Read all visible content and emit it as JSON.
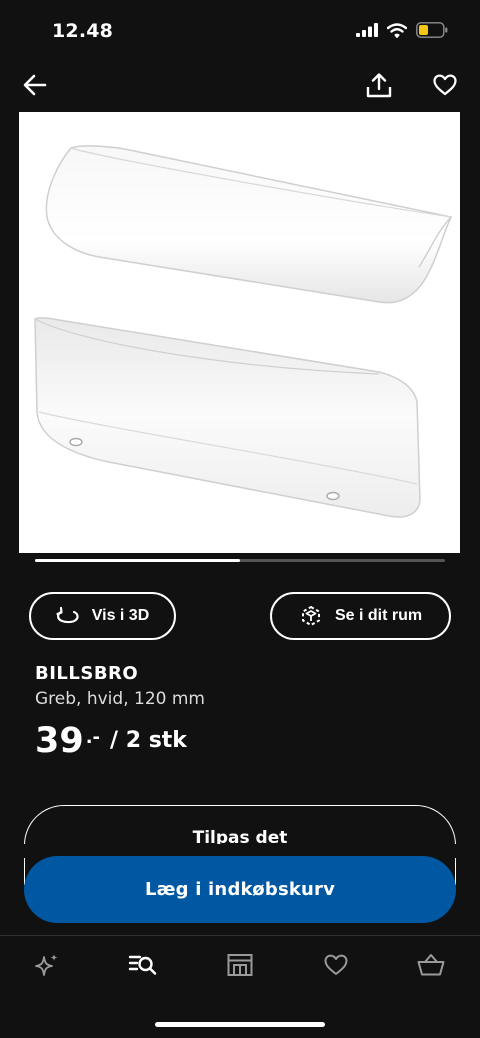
{
  "status_bar": {
    "time": "12.48",
    "icons": [
      "signal-icon",
      "wifi-icon",
      "battery-icon"
    ],
    "battery_color": "#f5c518"
  },
  "top_nav": {
    "icons": [
      "back-arrow-icon",
      "share-icon",
      "heart-icon"
    ]
  },
  "gallery": {
    "progress": 0.5
  },
  "actions": {
    "view_3d": "Vis i 3D",
    "view_in_room": "Se i dit rum"
  },
  "product": {
    "name": "BILLSBRO",
    "description": "Greb, hvid, 120 mm",
    "price_integer": "39",
    "price_decimal": ".-",
    "price_unit": "/ 2 stk"
  },
  "customize": {
    "label": "Tilpas det"
  },
  "cart": {
    "add_label": "Læg i indkøbskurv",
    "button_color": "#0058a3"
  },
  "tab_bar": {
    "items": [
      "sparkle-icon",
      "search-list-icon",
      "store-icon",
      "heart-icon",
      "basket-icon"
    ]
  }
}
